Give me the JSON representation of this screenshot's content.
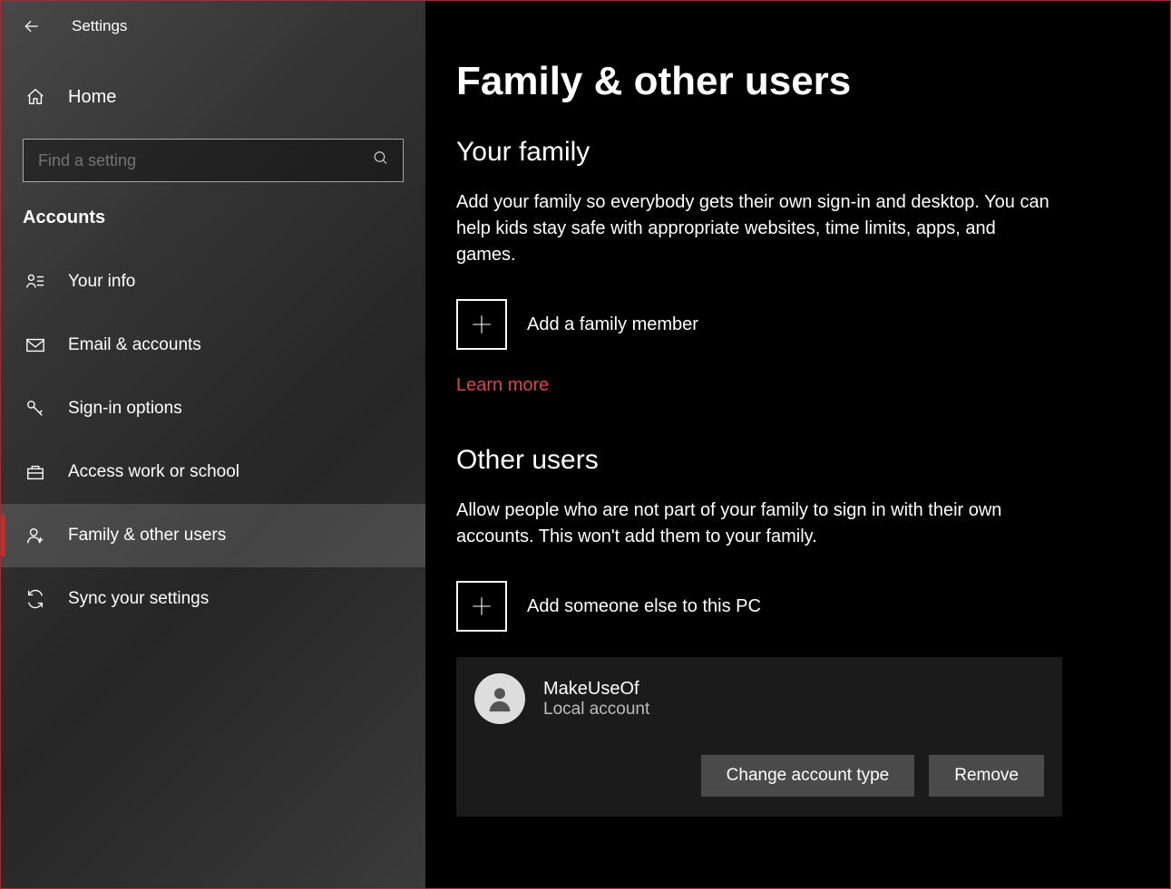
{
  "app_title": "Settings",
  "home_label": "Home",
  "search_placeholder": "Find a setting",
  "category": "Accounts",
  "nav": [
    {
      "id": "your-info",
      "label": "Your info"
    },
    {
      "id": "email-accounts",
      "label": "Email & accounts"
    },
    {
      "id": "signin-options",
      "label": "Sign-in options"
    },
    {
      "id": "access-work-school",
      "label": "Access work or school"
    },
    {
      "id": "family-other-users",
      "label": "Family & other users"
    },
    {
      "id": "sync-settings",
      "label": "Sync your settings"
    }
  ],
  "page_title": "Family & other users",
  "family": {
    "heading": "Your family",
    "description": "Add your family so everybody gets their own sign-in and desktop. You can help kids stay safe with appropriate websites, time limits, apps, and games.",
    "add_label": "Add a family member",
    "learn_more": "Learn more"
  },
  "other": {
    "heading": "Other users",
    "description": "Allow people who are not part of your family to sign in with their own accounts. This won't add them to your family.",
    "add_label": "Add someone else to this PC"
  },
  "user": {
    "name": "MakeUseOf",
    "subtitle": "Local account",
    "change_btn": "Change account type",
    "remove_btn": "Remove"
  },
  "colors": {
    "accent": "#d24a4a",
    "selection_bar": "#c52d2d"
  }
}
